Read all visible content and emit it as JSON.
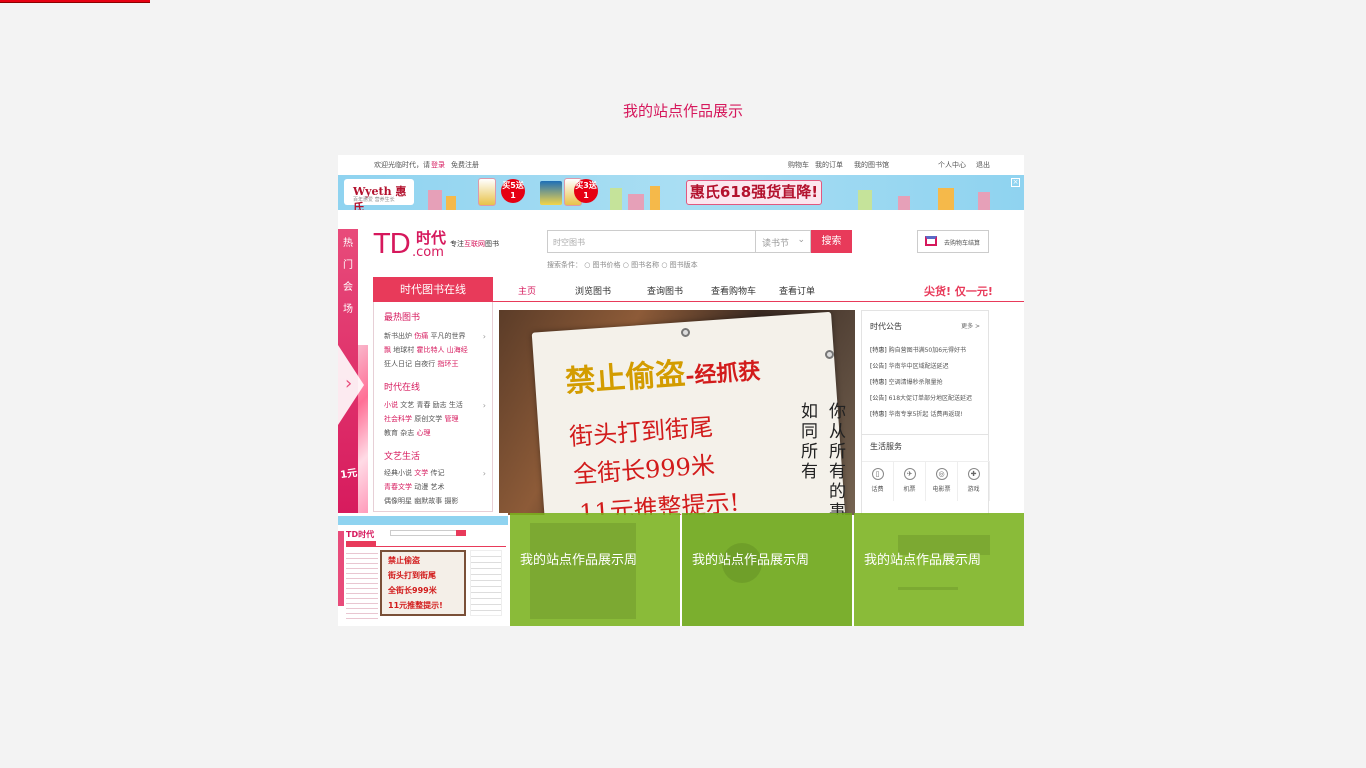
{
  "page": {
    "title": "我的站点作品展示"
  },
  "site": {
    "topbar": {
      "welcome": "欢迎光临时代，请",
      "login": "登录",
      "register": "免费注册",
      "cart": "购物车",
      "orders": "我的订单",
      "booklist": "我的图书馆",
      "user_center": "个人中心",
      "logout": "退出"
    },
    "banner": {
      "brand": "Wyeth 惠氏",
      "brand_sub": "百年惠爱 营养生长",
      "buy5": "买5送1",
      "buy3": "买3送1",
      "promo": "惠氏618强货直降!"
    },
    "logo": {
      "td": "TD",
      "cn": "时代",
      "com": ".com",
      "tag_pre": "专注",
      "tag_hl": "互联网",
      "tag_post": "图书"
    },
    "search": {
      "placeholder": "时空图书",
      "select": "读书节",
      "button": "搜索",
      "options": "搜索条件： ○ 图书价格 ○ 图书名称 ○ 图书版本"
    },
    "cart_button": "去购物车结算",
    "side_text": [
      "热",
      "门",
      "会",
      "场"
    ],
    "side_badge": "1元",
    "nav": {
      "category_title": "时代图书在线",
      "items": [
        "主页",
        "浏览图书",
        "查询图书",
        "查看购物车",
        "查看订单"
      ],
      "hot": "尖货! 仅一元!"
    },
    "categories": [
      {
        "title": "最热图书",
        "rows": [
          {
            "a": "新书出炉",
            "b": "伤痛",
            "c": "平凡的世界"
          },
          {
            "a": "飘",
            "b": "地球村",
            "c": "霍比特人 山海经"
          },
          {
            "a": "狂人日记",
            "b": "自夜行",
            "c": "指环王"
          }
        ]
      },
      {
        "title": "时代在线",
        "rows": [
          {
            "a": "小说",
            "b": "文艺 青春 励志 生活",
            "c": ""
          },
          {
            "a": "社会科学",
            "b": "原创文学",
            "c": "管理"
          },
          {
            "a": "教育",
            "b": "杂志",
            "c": "心理"
          }
        ]
      },
      {
        "title": "文艺生活",
        "rows": [
          {
            "a": "经典小说",
            "b": "文学",
            "c": "传记"
          },
          {
            "a": "青春文学",
            "b": "动漫",
            "c": "艺术"
          },
          {
            "a": "偶像明星",
            "b": "幽默故事",
            "c": "摄影"
          }
        ]
      }
    ],
    "photo_sign": {
      "line1": "禁止偷盗",
      "line1b": "-经抓获",
      "line2": "街头打到街尾",
      "line3": "全街长999米",
      "line4": "11元推整提示!",
      "vertical1": "如同所有",
      "vertical2": "你从所有的事物"
    },
    "announcements": {
      "title": "时代公告",
      "more": "更多 >",
      "items": [
        {
          "tag": "[特惠]",
          "text": "购自营图书满50加6元得好书"
        },
        {
          "tag": "[公告]",
          "text": "华南华中区域配送延迟"
        },
        {
          "tag": "[特惠]",
          "text": "空调清爆秒杀限量抢"
        },
        {
          "tag": "[公告]",
          "text": "618大促订单部分地区配送延迟"
        },
        {
          "tag": "[特惠]",
          "text": "华南专享5折起 话费再返现!"
        }
      ]
    },
    "life_services": {
      "title": "生活服务",
      "items": [
        {
          "label": "话费",
          "icon": "phone-icon"
        },
        {
          "label": "机票",
          "icon": "plane-icon"
        },
        {
          "label": "电影票",
          "icon": "film-icon"
        },
        {
          "label": "游戏",
          "icon": "gamepad-icon"
        }
      ]
    }
  },
  "thumbnails": [
    {
      "label": ""
    },
    {
      "label": "我的站点作品展示周"
    },
    {
      "label": "我的站点作品展示周"
    },
    {
      "label": "我的站点作品展示周"
    }
  ],
  "mini": {
    "logo": "TD时代",
    "sign1": "禁止偷盗",
    "sign2": "街头打到街尾",
    "sign3": "全街长999米",
    "sign4": "11元推整提示!"
  },
  "colors": {
    "accent": "#d6185c",
    "nav_red": "#e83a5a",
    "overlay_green": "#7ab21e",
    "top_bar": "#e60012"
  }
}
